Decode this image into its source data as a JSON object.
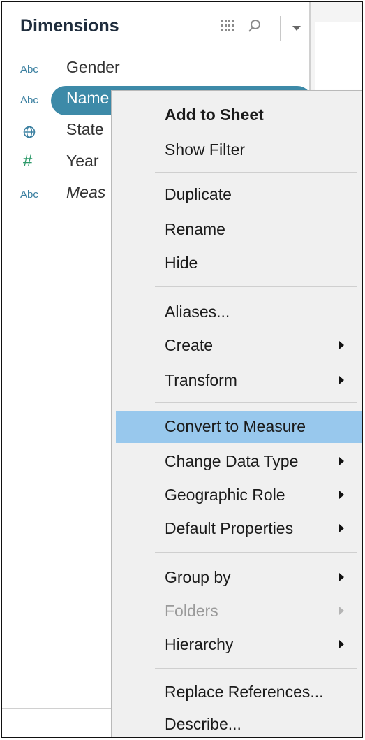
{
  "pane": {
    "title": "Dimensions",
    "fields": [
      {
        "type": "Abc",
        "name": "Gender"
      },
      {
        "type": "Abc",
        "name": "Name",
        "selected": true
      },
      {
        "type": "geo",
        "name": "State"
      },
      {
        "type": "#",
        "name": "Year"
      },
      {
        "type": "Abc",
        "name": "Meas"
      }
    ]
  },
  "menu": {
    "add_to_sheet": "Add to Sheet",
    "show_filter": "Show Filter",
    "duplicate": "Duplicate",
    "rename": "Rename",
    "hide": "Hide",
    "aliases": "Aliases...",
    "create": "Create",
    "transform": "Transform",
    "convert_to_measure": "Convert to Measure",
    "change_data_type": "Change Data Type",
    "geographic_role": "Geographic Role",
    "default_properties": "Default Properties",
    "group_by": "Group by",
    "folders": "Folders",
    "hierarchy": "Hierarchy",
    "replace_references": "Replace References...",
    "describe": "Describe..."
  },
  "colors": {
    "selected_pill": "#3d8aa8",
    "menu_highlight": "#98c8ed",
    "type_abc": "#3a7fa0",
    "type_number": "#2e9a6a"
  }
}
